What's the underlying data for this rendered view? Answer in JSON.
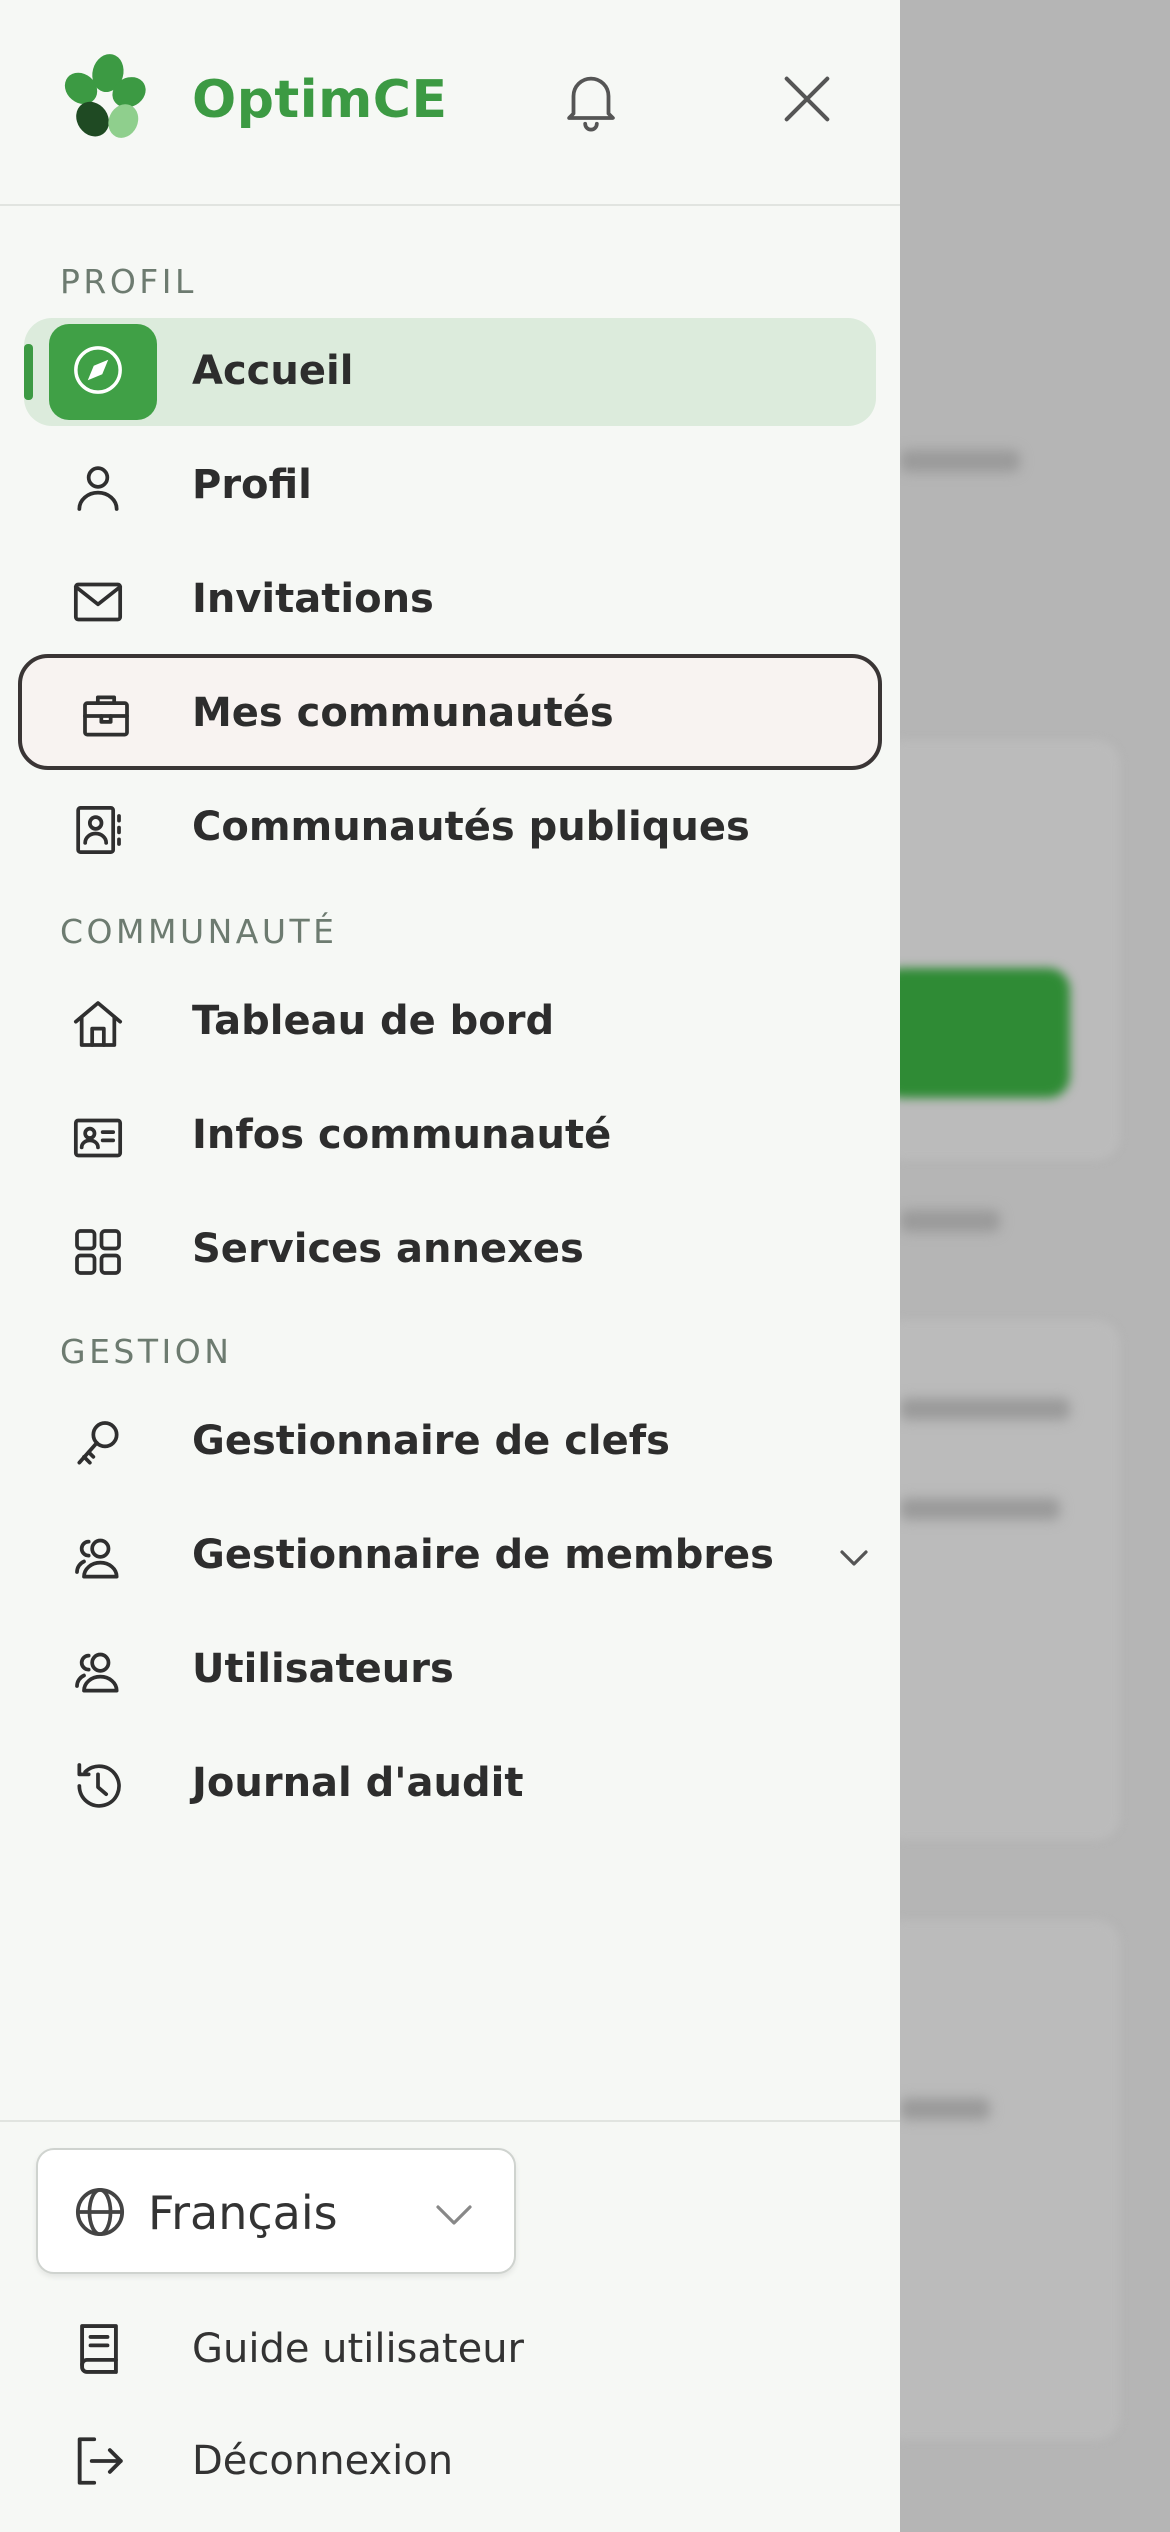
{
  "app": {
    "name": "OptimCE",
    "brand_color": "#3c9a43"
  },
  "header": {
    "bell_icon": "bell-icon",
    "close_icon": "close-icon"
  },
  "sections": {
    "profil": "PROFIL",
    "communaute": "COMMUNAUTÉ",
    "gestion": "GESTION"
  },
  "nav": {
    "accueil": "Accueil",
    "profil": "Profil",
    "invitations": "Invitations",
    "mes_communautes": "Mes communautés",
    "communautes_publiques": "Communautés publiques",
    "tableau_de_bord": "Tableau de bord",
    "infos_communaute": "Infos communauté",
    "services_annexes": "Services annexes",
    "gestionnaire_clefs": "Gestionnaire de clefs",
    "gestionnaire_membres": "Gestionnaire de membres",
    "utilisateurs": "Utilisateurs",
    "journal_audit": "Journal d'audit"
  },
  "footer": {
    "language": "Français",
    "guide": "Guide utilisateur",
    "logout": "Déconnexion"
  },
  "colors": {
    "active_bg": "#dcebdc",
    "active_icon_bg": "#40a046",
    "focus_border": "#3a3535"
  }
}
